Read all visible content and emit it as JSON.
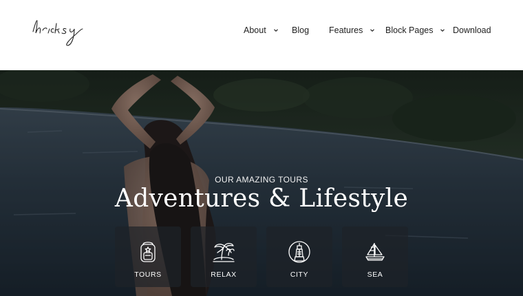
{
  "brand": {
    "logo_text": "bricksy"
  },
  "nav": {
    "items": [
      {
        "label": "About",
        "has_dropdown": true
      },
      {
        "label": "Blog",
        "has_dropdown": false
      },
      {
        "label": "Features",
        "has_dropdown": true
      },
      {
        "label": "Block Pages",
        "has_dropdown": true
      },
      {
        "label": "Download",
        "has_dropdown": false
      }
    ]
  },
  "hero": {
    "eyebrow": "OUR AMAZING TOURS",
    "headline": "Adventures & Lifestyle",
    "cards": [
      {
        "label": "TOURS",
        "icon": "backpack-icon"
      },
      {
        "label": "RELAX",
        "icon": "palm-island-icon"
      },
      {
        "label": "CITY",
        "icon": "tower-icon"
      },
      {
        "label": "SEA",
        "icon": "sailboat-icon"
      }
    ]
  },
  "colors": {
    "header_bg": "#ffffff",
    "nav_text": "#222222",
    "hero_text": "#ffffff",
    "card_bg": "#1e2228"
  }
}
